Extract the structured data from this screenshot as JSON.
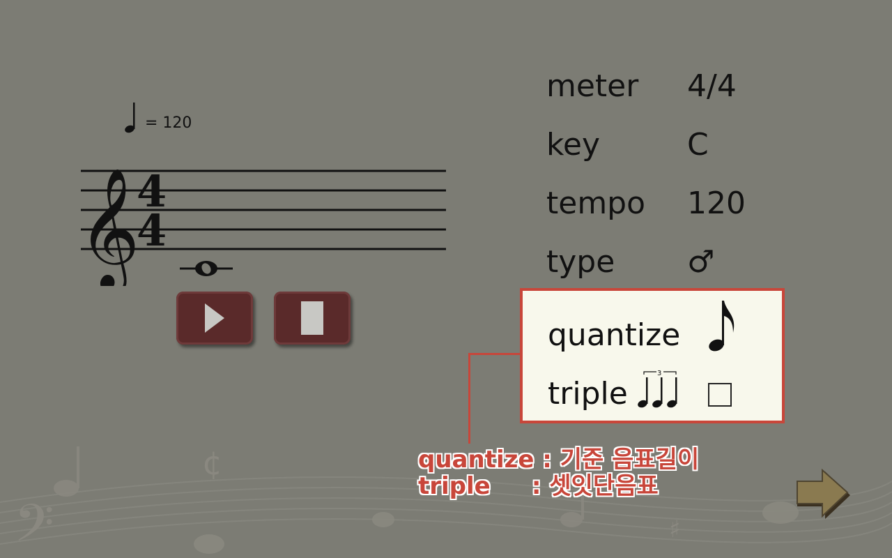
{
  "tempo_marking": {
    "equals_text": "= 120"
  },
  "staff": {
    "time_signature_top": "4",
    "time_signature_bottom": "4"
  },
  "properties": [
    {
      "label": "meter",
      "value": "4/4"
    },
    {
      "label": "key",
      "value": "C"
    },
    {
      "label": "tempo",
      "value": "120"
    },
    {
      "label": "type",
      "value": "♂"
    }
  ],
  "highlight_panel": {
    "quantize_label": "quantize",
    "quantize_icon": "eighth-note-icon",
    "triple_label": "triple",
    "triple_icon": "triplet-quarter-notes-icon",
    "triplet_number": "3",
    "triple_checked": false
  },
  "caption": {
    "line1_term": "quantize",
    "line1_desc": " : 기준 음표길이",
    "line2_term": "triple",
    "line2_desc": "     : 셋잇단음표"
  },
  "colors": {
    "background": "#7c7c74",
    "accent": "#c8463a",
    "button": "#5a2a2a",
    "panel": "#f8f8ec"
  }
}
